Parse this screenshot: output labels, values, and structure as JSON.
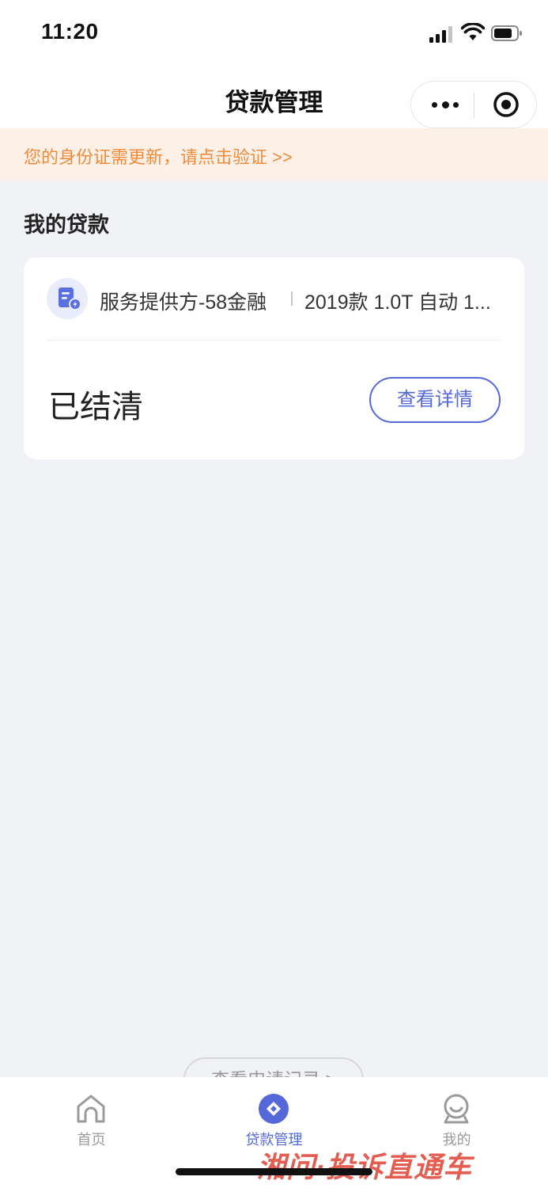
{
  "status_bar": {
    "time": "11:20"
  },
  "nav": {
    "title": "贷款管理"
  },
  "notice": {
    "text": "您的身份证需更新，请点击验证 >>"
  },
  "section": {
    "title": "我的贷款"
  },
  "loan_card": {
    "provider": "服务提供方-58金融",
    "car_model": "2019款 1.0T 自动 1...",
    "status": "已结清",
    "detail_button": "查看详情"
  },
  "records_button": "查看申请记录 >",
  "tabs": [
    {
      "label": "首页",
      "active": false
    },
    {
      "label": "贷款管理",
      "active": true
    },
    {
      "label": "我的",
      "active": false
    }
  ],
  "watermark": "湘问·投诉直通车",
  "colors": {
    "accent": "#5568d8",
    "notice_text": "#ee8b3d",
    "notice_bg": "#fdf1e7",
    "background": "#f1f2f6"
  }
}
